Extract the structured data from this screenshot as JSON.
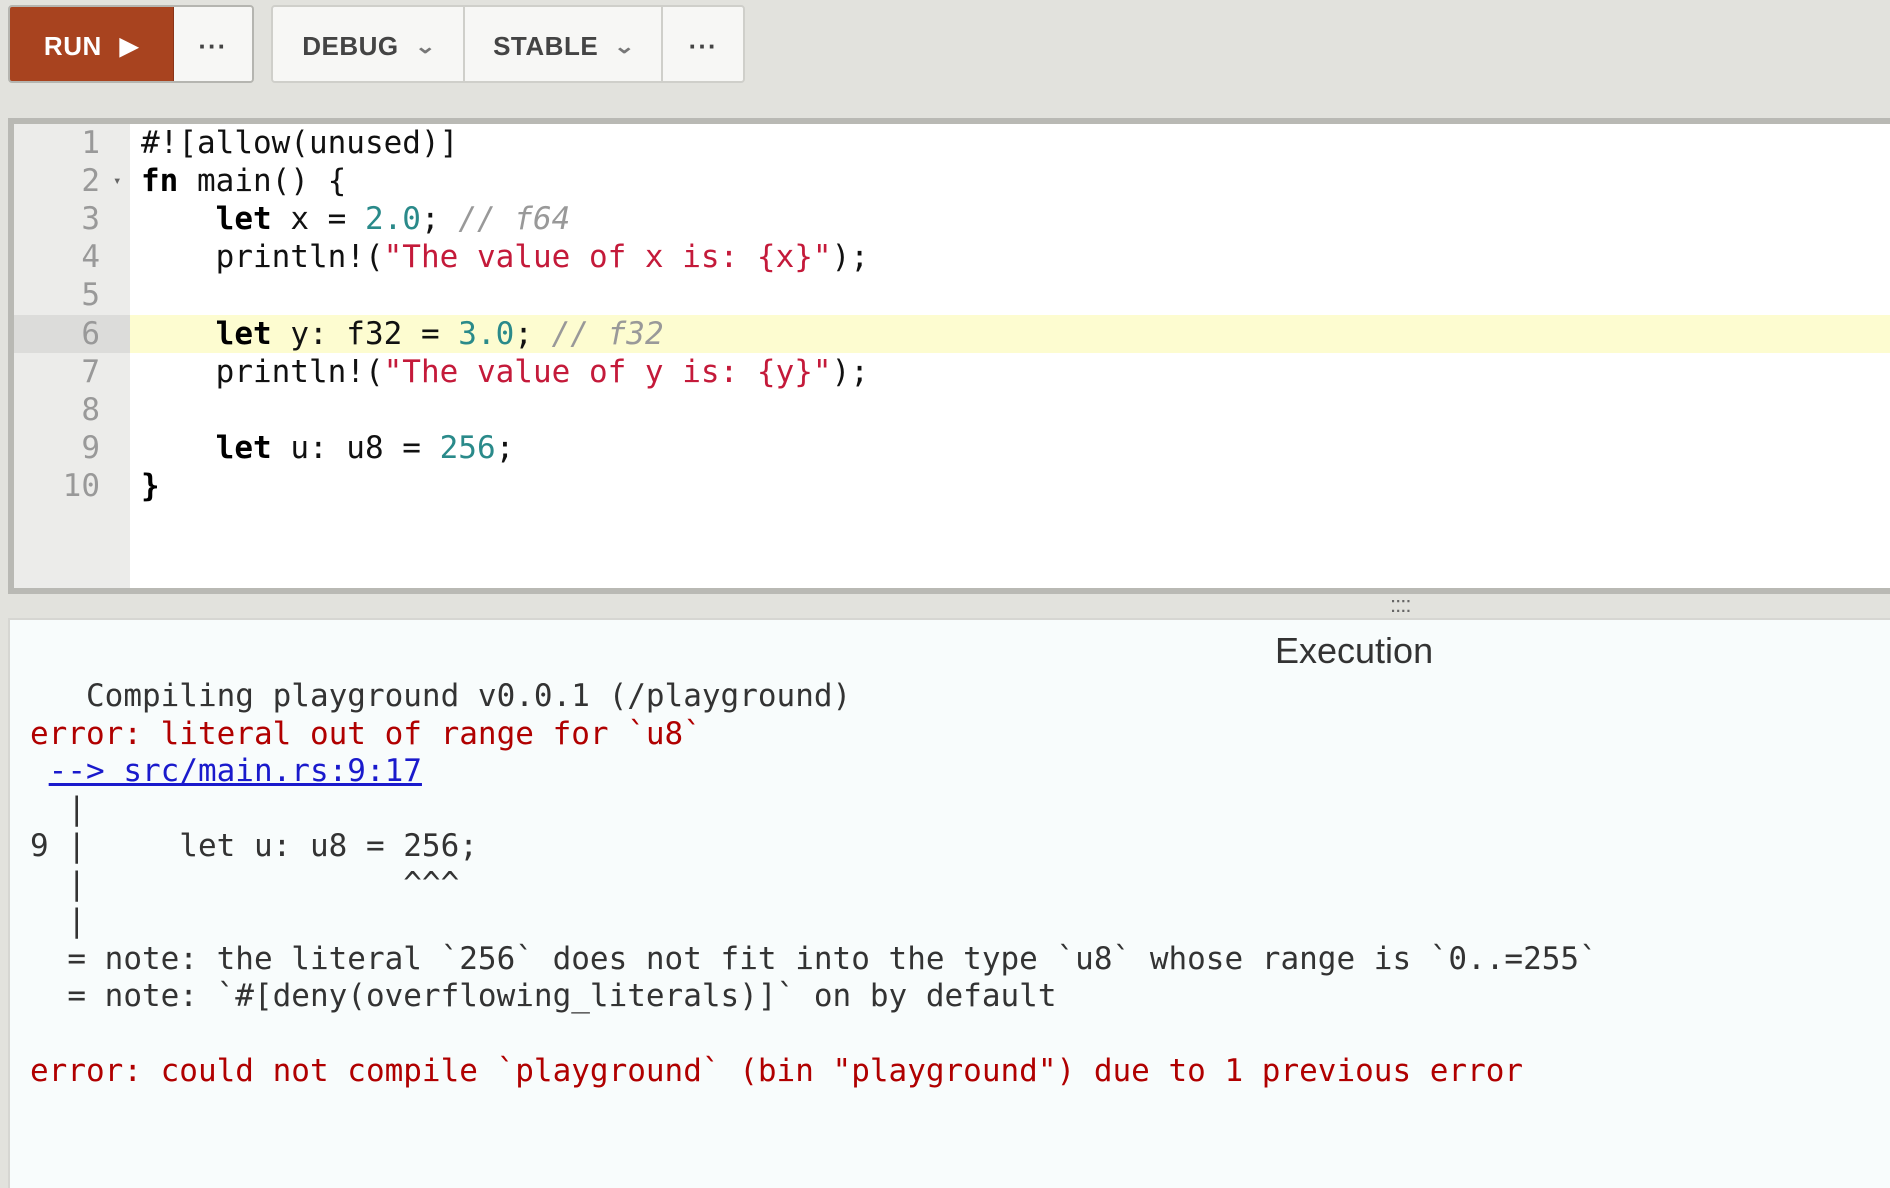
{
  "toolbar": {
    "run_label": "RUN",
    "run_icon": "play-icon",
    "more_label": "···",
    "debug_label": "DEBUG",
    "stable_label": "STABLE",
    "chevron_icon": "chevron-down-icon",
    "more2_label": "···",
    "colors": {
      "run_bg": "#a8431f"
    }
  },
  "editor": {
    "active_line": 6,
    "lines": [
      {
        "n": "1",
        "parts": [
          [
            "",
            "#![allow(unused)]"
          ]
        ]
      },
      {
        "n": "2",
        "fold": "▾",
        "parts": [
          [
            "kw",
            "fn"
          ],
          [
            "",
            " main() {"
          ]
        ]
      },
      {
        "n": "3",
        "parts": [
          [
            "",
            "    "
          ],
          [
            "kw",
            "let"
          ],
          [
            "",
            " x = "
          ],
          [
            "num",
            "2.0"
          ],
          [
            "",
            "; "
          ],
          [
            "cmt",
            "// f64"
          ]
        ]
      },
      {
        "n": "4",
        "parts": [
          [
            "",
            "    println!("
          ],
          [
            "str",
            "\"The value of x is: {x}\""
          ],
          [
            "",
            ");"
          ]
        ]
      },
      {
        "n": "5",
        "parts": []
      },
      {
        "n": "6",
        "parts": [
          [
            "",
            "    "
          ],
          [
            "kw",
            "let"
          ],
          [
            "",
            " y: f32 = "
          ],
          [
            "num",
            "3.0"
          ],
          [
            "",
            "; "
          ],
          [
            "cmt",
            "// f32"
          ]
        ]
      },
      {
        "n": "7",
        "parts": [
          [
            "",
            "    println!("
          ],
          [
            "str",
            "\"The value of y is: {y}\""
          ],
          [
            "",
            ");"
          ]
        ]
      },
      {
        "n": "8",
        "parts": []
      },
      {
        "n": "9",
        "parts": [
          [
            "",
            "    "
          ],
          [
            "kw",
            "let"
          ],
          [
            "",
            " u: u8 = "
          ],
          [
            "num",
            "256"
          ],
          [
            "",
            ";"
          ]
        ]
      },
      {
        "n": "10",
        "parts": [
          [
            "kw",
            "}"
          ]
        ]
      }
    ]
  },
  "splitter": {
    "handle": "::::"
  },
  "output": {
    "title": "Execution",
    "lines": [
      {
        "cls": "",
        "text": "   Compiling playground v0.0.1 (/playground)"
      },
      {
        "cls": "err",
        "text": "error: literal out of range for `u8`"
      },
      {
        "cls": "",
        "text": " ",
        "link": "--> src/main.rs:9:17"
      },
      {
        "cls": "",
        "text": "  |"
      },
      {
        "cls": "",
        "text": "9 |     let u: u8 = 256;"
      },
      {
        "cls": "",
        "text": "  |                 ^^^"
      },
      {
        "cls": "",
        "text": "  |"
      },
      {
        "cls": "",
        "text": "  = note: the literal `256` does not fit into the type `u8` whose range is `0..=255`"
      },
      {
        "cls": "",
        "text": "  = note: `#[deny(overflowing_literals)]` on by default"
      },
      {
        "cls": "",
        "text": ""
      },
      {
        "cls": "err",
        "text": "error: could not compile `playground` (bin \"playground\") due to 1 previous error"
      }
    ]
  }
}
